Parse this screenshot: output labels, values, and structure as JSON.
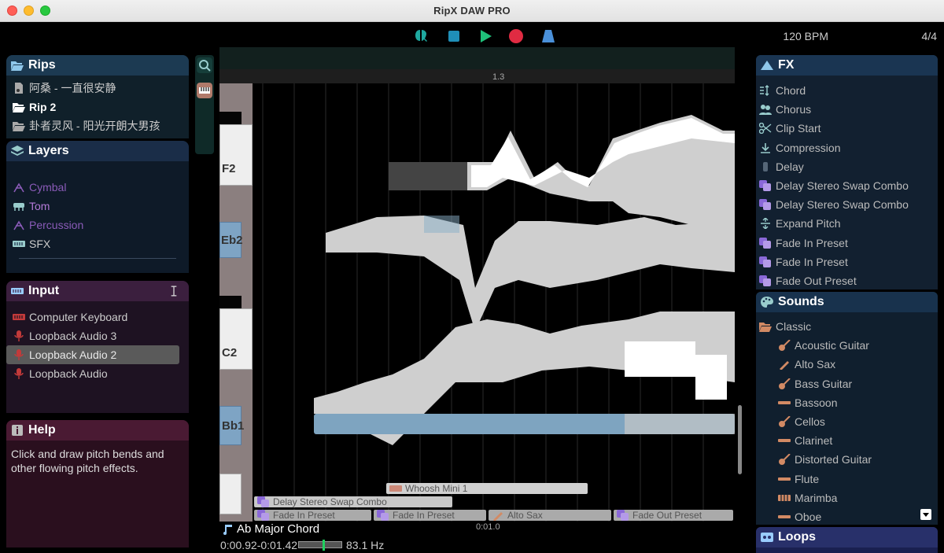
{
  "window": {
    "title": "RipX DAW PRO"
  },
  "transport": {
    "bpm": "120 BPM",
    "time_signature": "4/4",
    "colors": {
      "accent": "#1fa9a0",
      "play": "#1fc07a",
      "record": "#e02b42",
      "tuner": "#4a90d9"
    }
  },
  "rips": {
    "title": "Rips",
    "items": [
      {
        "label": "阿桑 - 一直很安静",
        "icon": "file-audio-icon",
        "active": false
      },
      {
        "label": "Rip 2",
        "icon": "folder-open-icon",
        "active": true
      },
      {
        "label": "卦者灵风 - 阳光开朗大男孩",
        "icon": "folder-open-icon",
        "active": false
      }
    ]
  },
  "layers": {
    "title": "Layers",
    "items": [
      {
        "label": "Cymbal",
        "icon": "cymbal-icon",
        "color": "#8a5bb8"
      },
      {
        "label": "Tom",
        "icon": "tom-icon",
        "color": "#b47ad8"
      },
      {
        "label": "Percussion",
        "icon": "percussion-icon",
        "color": "#8a5bb8"
      },
      {
        "label": "SFX",
        "icon": "sfx-icon",
        "color": "#cccccc"
      }
    ]
  },
  "input": {
    "title": "Input",
    "items": [
      {
        "label": "Computer Keyboard",
        "icon": "keyboard-icon",
        "selected": false
      },
      {
        "label": "Loopback Audio 3",
        "icon": "microphone-icon",
        "selected": false
      },
      {
        "label": "Loopback Audio 2",
        "icon": "microphone-icon",
        "selected": true
      },
      {
        "label": "Loopback Audio",
        "icon": "microphone-icon",
        "selected": false
      }
    ]
  },
  "help": {
    "title": "Help",
    "text": "Click and draw pitch bends and other flowing pitch effects."
  },
  "editor": {
    "ruler_label": "1.3",
    "keys": {
      "f2": "F2",
      "eb2": "Eb2",
      "c2": "C2",
      "bb1": "Bb1"
    },
    "clips": {
      "whoosh": "Whoosh Mini 1",
      "delay": "Delay Stereo Swap Combo",
      "fade_in_1": "Fade In Preset",
      "fade_in_2": "Fade In Preset",
      "alto": "Alto Sax",
      "fade_out": "Fade Out Preset"
    },
    "timeline_label": "0:01.0"
  },
  "status": {
    "chord": "Ab Major Chord",
    "time_range": "0:00.92-0:01.42",
    "frequency": "83.1 Hz",
    "meter_level": 0.55
  },
  "fx": {
    "title": "FX",
    "items": [
      {
        "label": "Chord",
        "icon": "chord-icon"
      },
      {
        "label": "Chorus",
        "icon": "chorus-icon"
      },
      {
        "label": "Clip Start",
        "icon": "scissors-icon"
      },
      {
        "label": "Compression",
        "icon": "compression-icon"
      },
      {
        "label": "Delay",
        "icon": "delay-icon"
      },
      {
        "label": "Delay Stereo Swap Combo",
        "icon": "preset-icon"
      },
      {
        "label": "Delay Stereo Swap Combo",
        "icon": "preset-icon"
      },
      {
        "label": "Expand Pitch",
        "icon": "expand-pitch-icon"
      },
      {
        "label": "Fade In Preset",
        "icon": "preset-icon"
      },
      {
        "label": "Fade In Preset",
        "icon": "preset-icon"
      },
      {
        "label": "Fade Out Preset",
        "icon": "preset-icon"
      }
    ]
  },
  "sounds": {
    "title": "Sounds",
    "category": "Classic",
    "items": [
      {
        "label": "Acoustic Guitar",
        "icon": "guitar-icon",
        "color": "#d28a64"
      },
      {
        "label": "Alto Sax",
        "icon": "sax-icon",
        "color": "#d28a64"
      },
      {
        "label": "Bass Guitar",
        "icon": "guitar-icon",
        "color": "#d28a64"
      },
      {
        "label": "Bassoon",
        "icon": "bassoon-icon",
        "color": "#d28a64"
      },
      {
        "label": "Cellos",
        "icon": "cello-icon",
        "color": "#d28a64"
      },
      {
        "label": "Clarinet",
        "icon": "clarinet-icon",
        "color": "#d28a64"
      },
      {
        "label": "Distorted Guitar",
        "icon": "guitar-icon",
        "color": "#d28a64"
      },
      {
        "label": "Flute",
        "icon": "flute-icon",
        "color": "#d28a64"
      },
      {
        "label": "Marimba",
        "icon": "marimba-icon",
        "color": "#d28a64"
      },
      {
        "label": "Oboe",
        "icon": "oboe-icon",
        "color": "#d28a64"
      }
    ]
  },
  "loops": {
    "title": "Loops"
  }
}
